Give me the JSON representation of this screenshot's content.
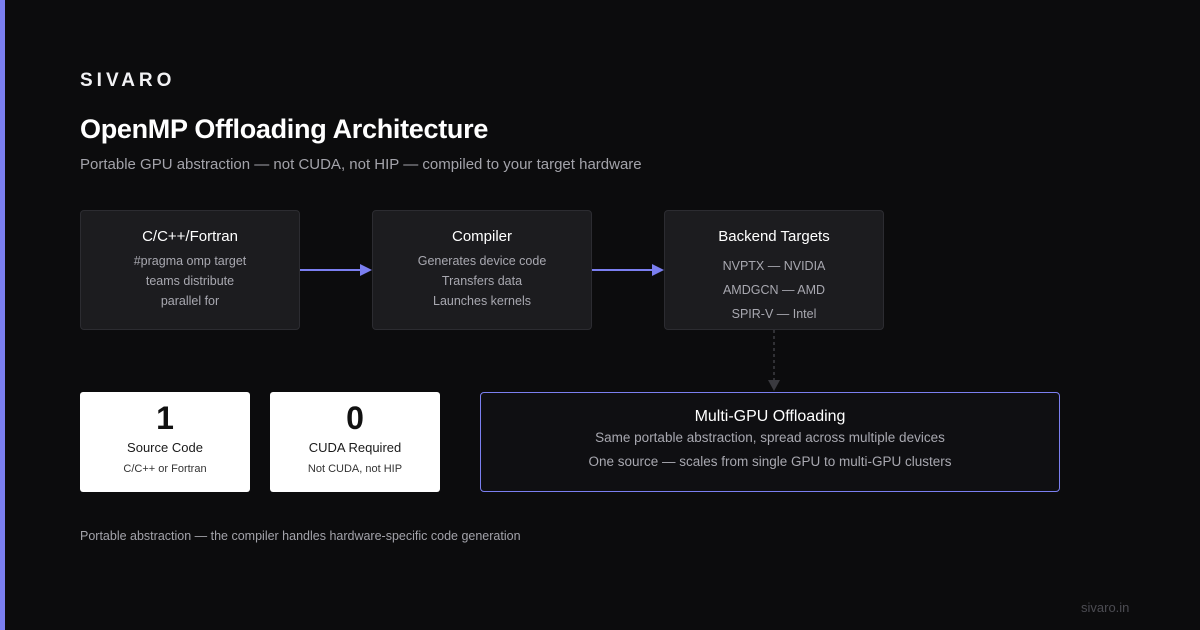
{
  "brand": "SIVARO",
  "title": "OpenMP Offloading Architecture",
  "subtitle": "Portable GPU abstraction — not CUDA, not HIP — compiled to your target hardware",
  "flow": [
    {
      "title": "C/C++/Fortran",
      "lines": [
        "#pragma omp target",
        "teams distribute",
        "parallel for"
      ]
    },
    {
      "title": "Compiler",
      "lines": [
        "Generates device code",
        "Transfers data",
        "Launches kernels"
      ]
    },
    {
      "title": "Backend Targets",
      "lines": [
        "NVPTX — NVIDIA",
        "AMDGCN — AMD",
        "SPIR-V — Intel"
      ]
    }
  ],
  "stats": [
    {
      "value": "1",
      "label": "Source Code",
      "sub": "C/C++ or Fortran"
    },
    {
      "value": "0",
      "label": "CUDA Required",
      "sub": "Not CUDA, not HIP"
    }
  ],
  "multi_gpu": {
    "title": "Multi-GPU Offloading",
    "lines": [
      "Same portable abstraction, spread across multiple devices",
      "One source — scales from single GPU to multi-GPU clusters"
    ]
  },
  "footnote": "Portable abstraction — the compiler handles hardware-specific code generation",
  "url": "sivaro.in",
  "colors": {
    "accent": "#7b7ff0",
    "background": "#0c0c0d",
    "box": "#1c1c1f"
  }
}
